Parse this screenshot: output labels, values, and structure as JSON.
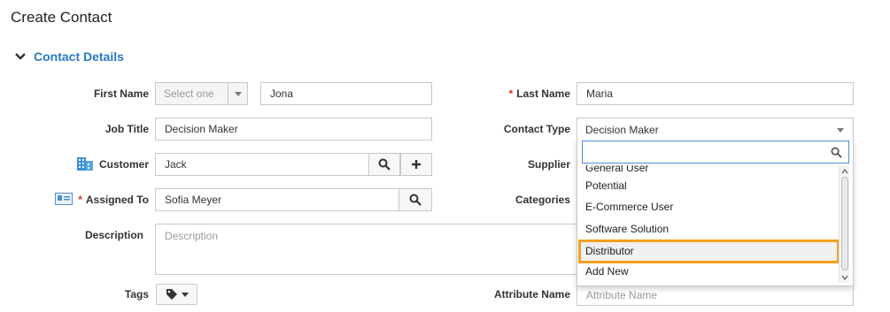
{
  "page": {
    "title": "Create Contact"
  },
  "section": {
    "title": "Contact Details"
  },
  "form": {
    "first_name": {
      "label": "First Name",
      "salutation_placeholder": "Select one",
      "value": "Jona"
    },
    "last_name": {
      "label": "Last Name",
      "value": "Maria"
    },
    "job_title": {
      "label": "Job Title",
      "value": "Decision Maker"
    },
    "contact_type": {
      "label": "Contact Type",
      "value": "Decision Maker"
    },
    "customer": {
      "label": "Customer",
      "value": "Jack"
    },
    "supplier": {
      "label": "Supplier"
    },
    "assigned_to": {
      "label": "Assigned To",
      "value": "Sofia Meyer"
    },
    "categories": {
      "label": "Categories"
    },
    "description": {
      "label": "Description",
      "placeholder": "Description"
    },
    "tags": {
      "label": "Tags"
    },
    "attribute_name": {
      "label": "Attribute Name",
      "placeholder": "Attribute Name"
    }
  },
  "dropdown": {
    "search_value": "",
    "partial_item": "General User",
    "items": [
      "Potential",
      "E-Commerce User",
      "Software Solution",
      "Distributor",
      "Add New"
    ],
    "highlighted": "Distributor"
  },
  "colors": {
    "accent": "#2a78c8",
    "required": "#d9342b",
    "highlight_outline": "#f2a01d",
    "search_focus": "#4e8fd2"
  },
  "icons": {
    "section_toggle": "chevron-down-icon",
    "customer": "building-icon",
    "assigned_to": "id-card-icon",
    "search": "search-icon",
    "add": "plus-icon",
    "tags": "tag-icon"
  }
}
